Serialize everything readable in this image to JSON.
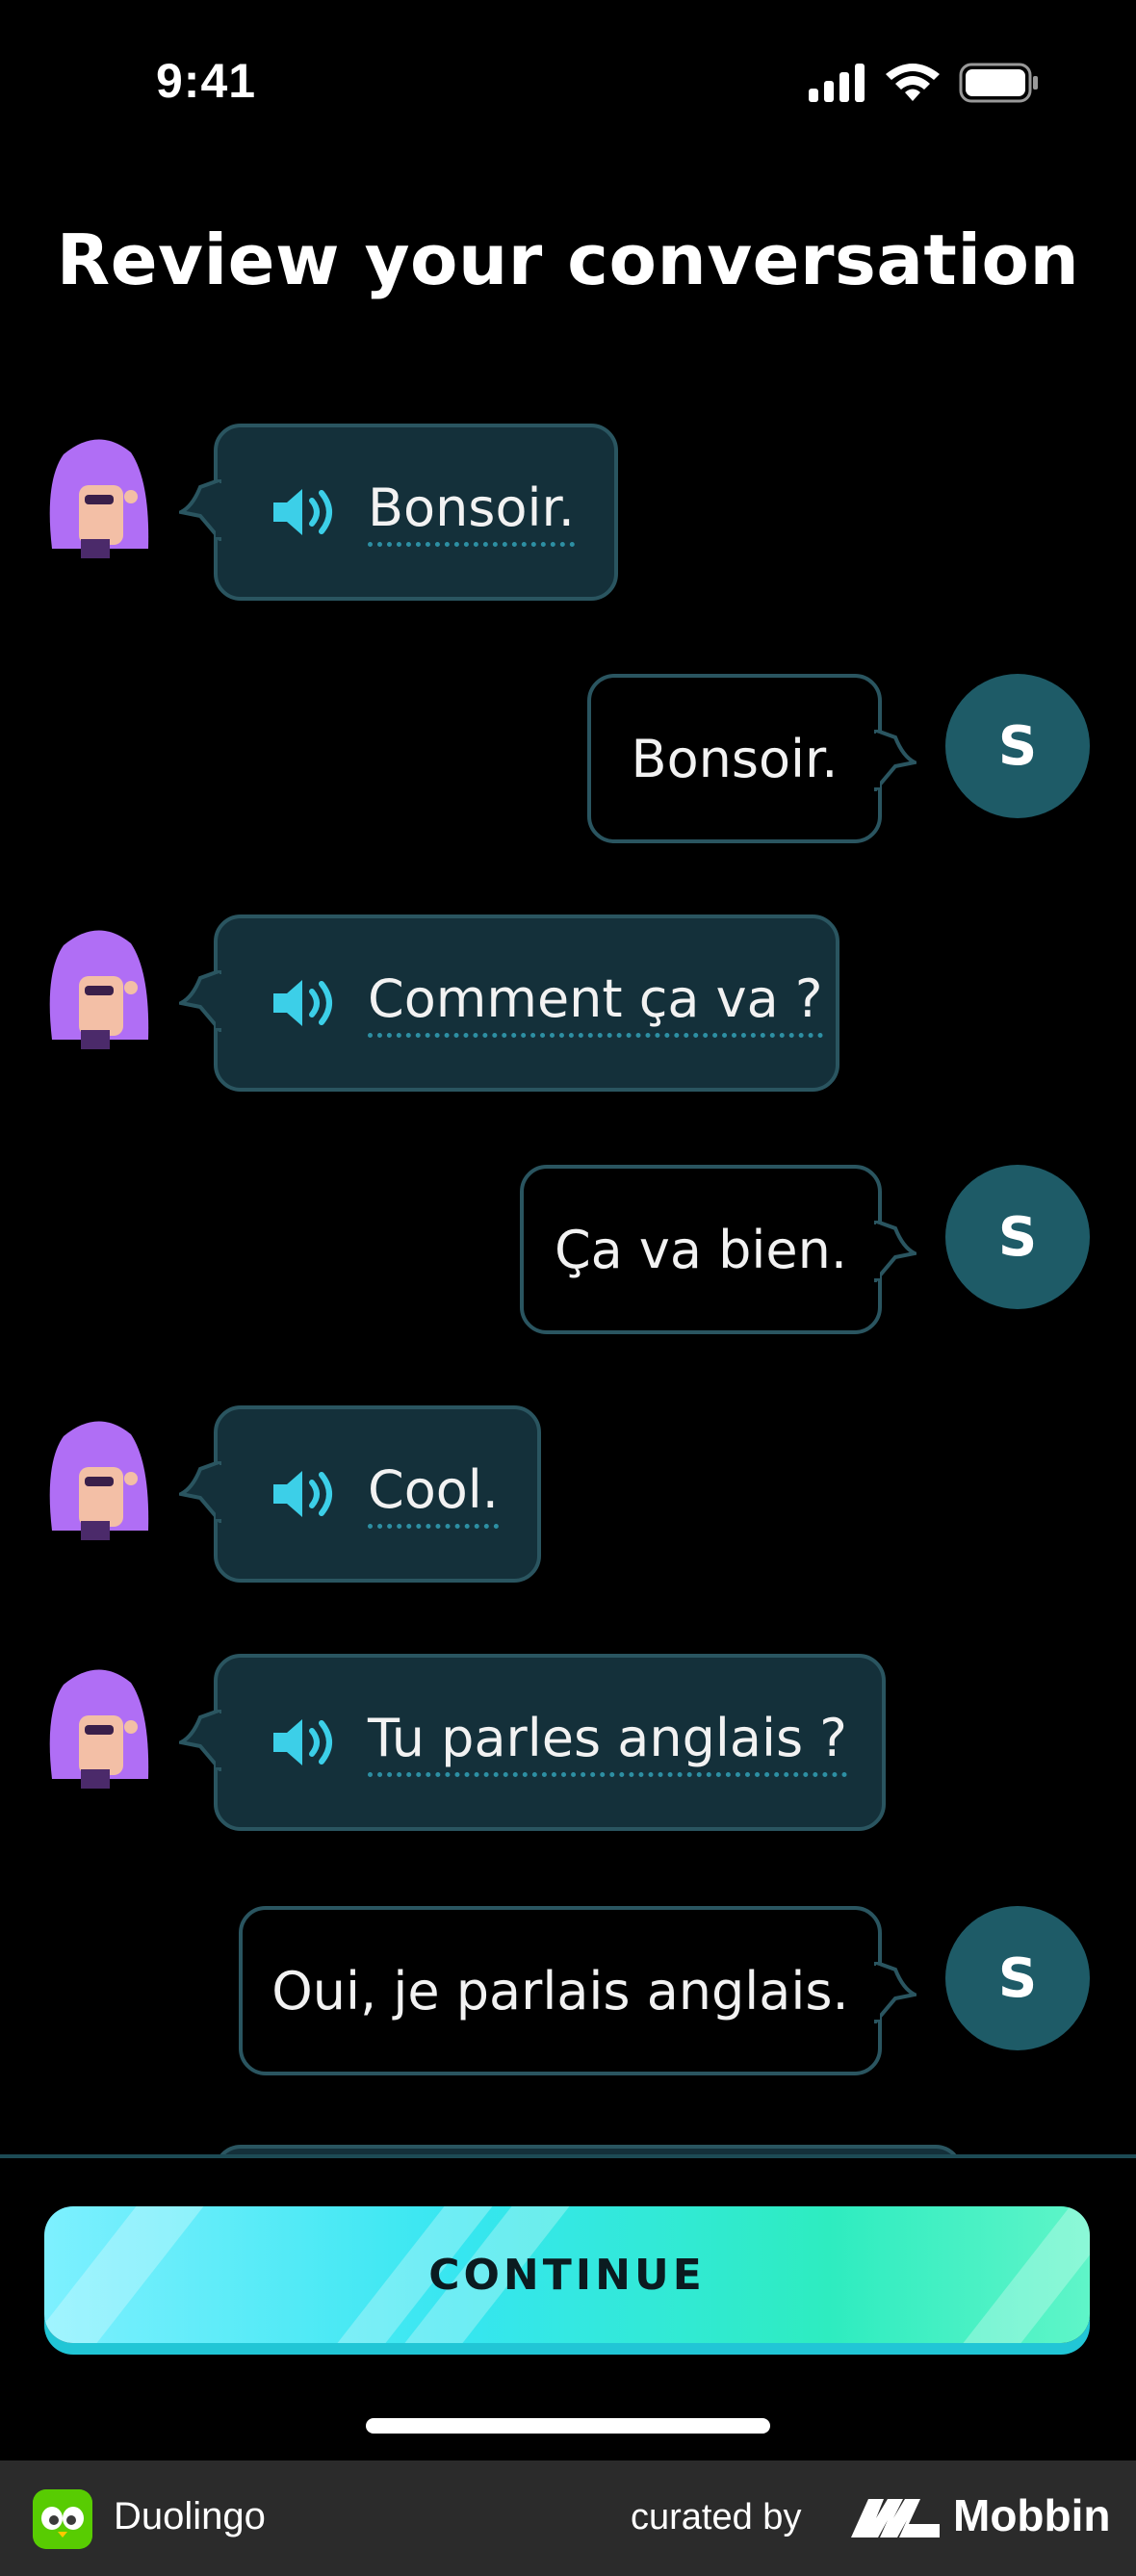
{
  "status_bar": {
    "time": "9:41"
  },
  "header": {
    "title": "Review your conversation"
  },
  "messages": [
    {
      "from": "character",
      "text": "Bonsoir."
    },
    {
      "from": "user",
      "text": "Bonsoir.",
      "avatar_initial": "S"
    },
    {
      "from": "character",
      "text": "Comment ça va ?"
    },
    {
      "from": "user",
      "text": "Ça va bien.",
      "avatar_initial": "S"
    },
    {
      "from": "character",
      "text": "Cool."
    },
    {
      "from": "character",
      "text": "Tu parles anglais ?"
    },
    {
      "from": "user",
      "text": "Oui, je parlais anglais.",
      "avatar_initial": "S"
    }
  ],
  "actions": {
    "continue_label": "CONTINUE"
  },
  "footer": {
    "app_name": "Duolingo",
    "curated_by": "curated by",
    "brand": "Mobbin"
  },
  "colors": {
    "background": "#000000",
    "bubble_character": "#14303a",
    "bubble_border": "#2a5560",
    "user_avatar": "#1e5b67",
    "speaker_icon": "#3ccfe8",
    "continue_gradient_start": "#7df0ff",
    "continue_gradient_end": "#5ff5c8"
  },
  "icons": {
    "character_avatar": "purple-haired-character-avatar",
    "speaker": "speaker-icon",
    "signal": "cellular-signal-icon",
    "wifi": "wifi-icon",
    "battery": "battery-icon"
  }
}
